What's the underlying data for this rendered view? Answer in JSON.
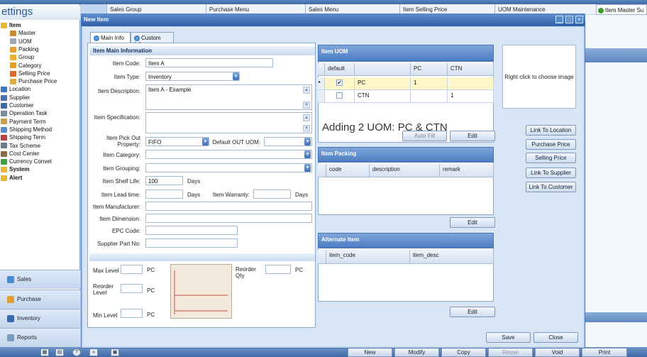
{
  "app_tabs": [
    "Sales Group",
    "Purchase Menu",
    "Sales Menu",
    "Item Selling Price",
    "UOM Maintenance"
  ],
  "right_tab": "Item Master Su",
  "left_panel": {
    "title": "ettings",
    "tree": [
      {
        "label": "Item",
        "bold": true,
        "indent": 0,
        "icon_color": "#e8b830"
      },
      {
        "label": "Master",
        "bold": false,
        "indent": 1,
        "icon_color": "#c88a30"
      },
      {
        "label": "UOM",
        "bold": false,
        "indent": 1,
        "icon_color": "#9aa8b8"
      },
      {
        "label": "Packing",
        "bold": false,
        "indent": 1,
        "icon_color": "#e0a030"
      },
      {
        "label": "Group",
        "bold": false,
        "indent": 1,
        "icon_color": "#e8b030"
      },
      {
        "label": "Category",
        "bold": false,
        "indent": 1,
        "icon_color": "#e0a030"
      },
      {
        "label": "Selling Price",
        "bold": false,
        "indent": 1,
        "icon_color": "#d86a30"
      },
      {
        "label": "Purchase Price",
        "bold": false,
        "indent": 1,
        "icon_color": "#d8b040"
      },
      {
        "label": "Location",
        "bold": false,
        "indent": 0,
        "icon_color": "#3a78c8"
      },
      {
        "label": "Supplier",
        "bold": false,
        "indent": 0,
        "icon_color": "#4a70b0"
      },
      {
        "label": "Customer",
        "bold": false,
        "indent": 0,
        "icon_color": "#3a6ab0"
      },
      {
        "label": "Operation Task",
        "bold": false,
        "indent": 0,
        "icon_color": "#7a8aa0"
      },
      {
        "label": "Payment Term",
        "bold": false,
        "indent": 0,
        "icon_color": "#d0a040"
      },
      {
        "label": "Shipping Method",
        "bold": false,
        "indent": 0,
        "icon_color": "#5a8ad0"
      },
      {
        "label": "Shipping Term",
        "bold": false,
        "indent": 0,
        "icon_color": "#c04040"
      },
      {
        "label": "Tax Scheme",
        "bold": false,
        "indent": 0,
        "icon_color": "#6a7a90"
      },
      {
        "label": "Cost Center",
        "bold": false,
        "indent": 0,
        "icon_color": "#8a6a40"
      },
      {
        "label": "Currency Convet",
        "bold": false,
        "indent": 0,
        "icon_color": "#40a040"
      },
      {
        "label": "System",
        "bold": true,
        "indent": 0,
        "icon_color": "#e8b830"
      },
      {
        "label": "Alert",
        "bold": true,
        "indent": 0,
        "icon_color": "#e8b830"
      }
    ],
    "modules": [
      {
        "label": "Sales",
        "icon_color": "#4a8ad0"
      },
      {
        "label": "Purchase",
        "icon_color": "#e0a030"
      },
      {
        "label": "Inventory",
        "icon_color": "#3a6ab0"
      },
      {
        "label": "Reports",
        "icon_color": "#7a9ac0"
      }
    ]
  },
  "dialog": {
    "title": "New Item",
    "tabs": {
      "main": "Main Info",
      "custom": "Custom Info"
    },
    "section_title": "Item Main Information",
    "labels": {
      "item_code": "Item Code:",
      "item_type": "Item Type:",
      "item_description": "Item Description:",
      "item_specification": "Item Specification:",
      "pick_out_property": "Item Pick Out\nProperty:",
      "default_out_uom": "Default OUT UOM:",
      "item_category": "Item Category:",
      "item_grouping": "Item Grouping:",
      "shelf_life": "Item Shelf Life:",
      "lead_time": "Item Lead time:",
      "warranty": "Item Warranty:",
      "manufacturer": "Item Manufacturer:",
      "dimension": "Item Dimension:",
      "epc_code": "EPC Code:",
      "supplier_part_no": "Supplier Part No:",
      "days": "Days",
      "max_level": "Max Level",
      "reorder_level": "Reorder\nLevel",
      "min_level": "Min Level",
      "reorder_qty": "Reorder\nQty",
      "pc": "PC"
    },
    "values": {
      "item_code": "Item A",
      "item_type": "Inventory",
      "item_description": "Item A  - Example",
      "pick_out_property": "FIFO",
      "shelf_life": "100"
    },
    "uom_grid": {
      "title": "Item UOM",
      "columns": [
        "default",
        "",
        "PC",
        "CTN"
      ],
      "rows": [
        {
          "checked": true,
          "uom": "PC",
          "pc": "1",
          "ctn": ""
        },
        {
          "checked": false,
          "uom": "CTN",
          "pc": "",
          "ctn": "1"
        }
      ],
      "auto_fill": "Auto Fill",
      "edit": "Edit"
    },
    "annotation": "Adding 2 UOM: PC & CTN",
    "packing_grid": {
      "title": "Item Packing",
      "columns": [
        "code",
        "description",
        "remark"
      ],
      "edit": "Edit"
    },
    "alternate_grid": {
      "title": "Alternate Item",
      "columns": [
        "item_code",
        "item_desc"
      ],
      "edit": "Edit"
    },
    "image_hint": "Right click to choose image",
    "link_buttons": [
      "Link To Location",
      "Purchase Price",
      "Selling Price",
      "Link To Supplier",
      "Link To Customer"
    ],
    "save": "Save",
    "close": "Close"
  },
  "bottom_buttons": [
    "New",
    "Modify",
    "Copy",
    "Reuse",
    "Void",
    "Print"
  ]
}
